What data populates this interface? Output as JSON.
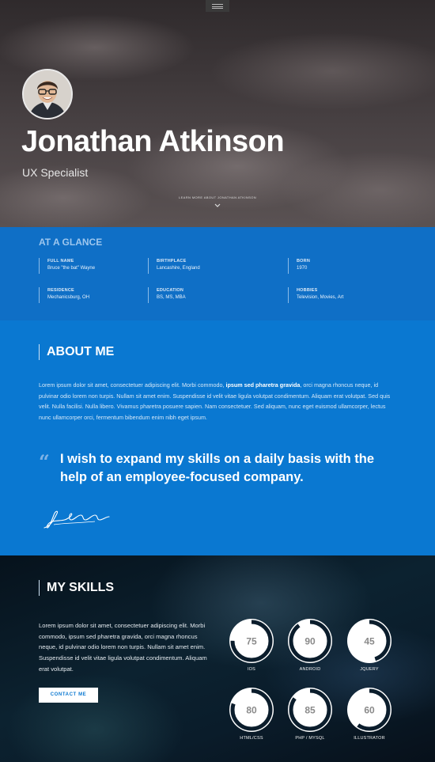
{
  "hero": {
    "name": "Jonathan Atkinson",
    "role": "UX Specialist",
    "learn_more": "LEARN MORE ABOUT JONATHAN ATKINSON"
  },
  "glance": {
    "title": "AT A GLANCE",
    "items": [
      {
        "label": "FULL NAME",
        "value": "Bruce \"the bat\" Wayne"
      },
      {
        "label": "BIRTHPLACE",
        "value": "Lancashire, England"
      },
      {
        "label": "BORN",
        "value": "1970"
      },
      {
        "label": "RESIDENCE",
        "value": "Mechanicsburg, OH"
      },
      {
        "label": "EDUCATION",
        "value": "BS, MS, MBA"
      },
      {
        "label": "HOBBIES",
        "value": "Television, Movies, Art"
      }
    ]
  },
  "about": {
    "title": "ABOUT ME",
    "text_before": "Lorem ipsum dolor sit amet, consectetuer adipiscing elit. Morbi commodo, ",
    "text_bold": "ipsum sed pharetra gravida",
    "text_after": ", orci magna rhoncus neque, id pulvinar odio lorem non turpis. Nullam sit amet enim. Suspendisse id velit vitae ligula volutpat condimentum. Aliquam erat volutpat. Sed quis velit. Nulla facilisi. Nulla libero. Vivamus pharetra posuere sapien. Nam consectetuer. Sed aliquam, nunc eget euismod ullamcorper, lectus nunc ullamcorper orci, fermentum bibendum enim nibh eget ipsum.",
    "quote_mark": "“",
    "quote": "I wish to expand my skills on a daily basis with the help of an employee-focused company."
  },
  "skills": {
    "title": "MY SKILLS",
    "text": "Lorem ipsum dolor sit amet, consectetuer adipiscing elit. Morbi commodo, ipsum sed pharetra gravida, orci magna rhoncus neque, id pulvinar odio lorem non turpis. Nullam sit amet enim. Suspendisse id velit vitae ligula volutpat condimentum. Aliquam erat volutpat.",
    "contact_label": "CONTACT ME",
    "items": [
      {
        "label": "IOS",
        "value": 75
      },
      {
        "label": "ANDROID",
        "value": 90
      },
      {
        "label": "JQUERY",
        "value": 45
      },
      {
        "label": "HTML/CSS",
        "value": 80
      },
      {
        "label": "PHP / MYSQL",
        "value": 85
      },
      {
        "label": "ILLUSTRATOR",
        "value": 60
      }
    ]
  },
  "colors": {
    "accent_blue": "#0a78d1",
    "glance_blue": "#0f6fc6"
  }
}
